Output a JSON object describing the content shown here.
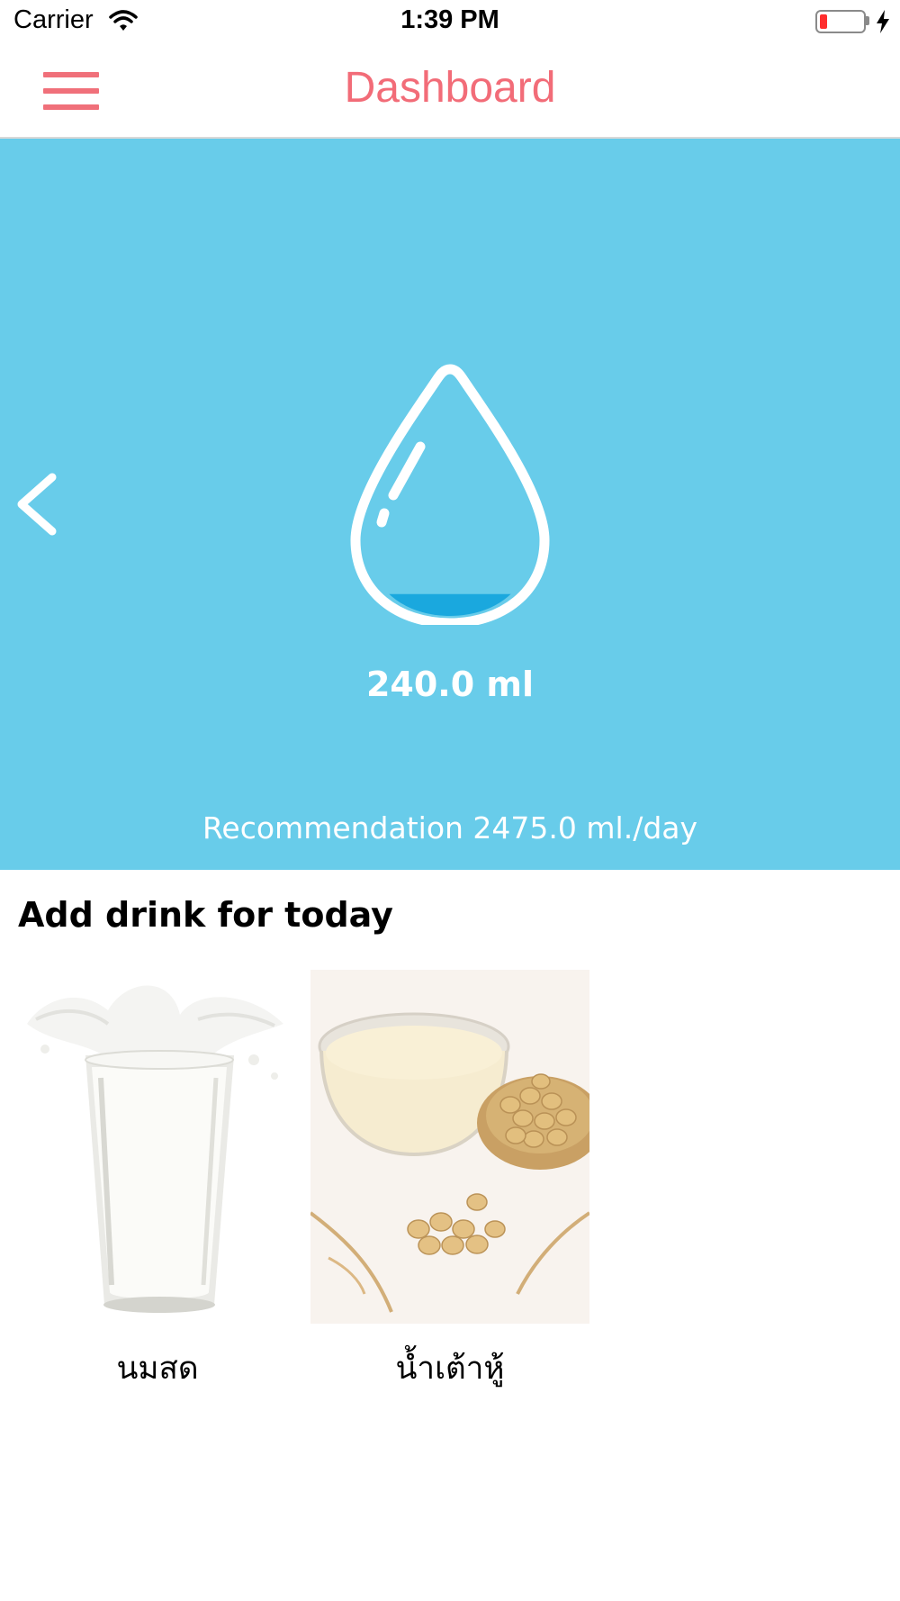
{
  "status_bar": {
    "carrier": "Carrier",
    "time": "1:39 PM",
    "battery_color": "#ff2d2d"
  },
  "nav": {
    "title": "Dashboard",
    "menu_icon": "hamburger-menu-icon",
    "accent_color": "#f26c78"
  },
  "hero": {
    "background_color": "#68ccea",
    "amount": "240.0 ml",
    "recommendation": "Recommendation 2475.0 ml./day",
    "water_drop_fill_fraction": 0.097,
    "back_icon": "chevron-left-icon"
  },
  "drinks_section": {
    "title": "Add drink for today",
    "items": [
      {
        "label": "นมสด",
        "image": "milk-glass-image"
      },
      {
        "label": "น้ำเต้าหู้",
        "image": "soy-milk-bowl-image"
      }
    ]
  }
}
